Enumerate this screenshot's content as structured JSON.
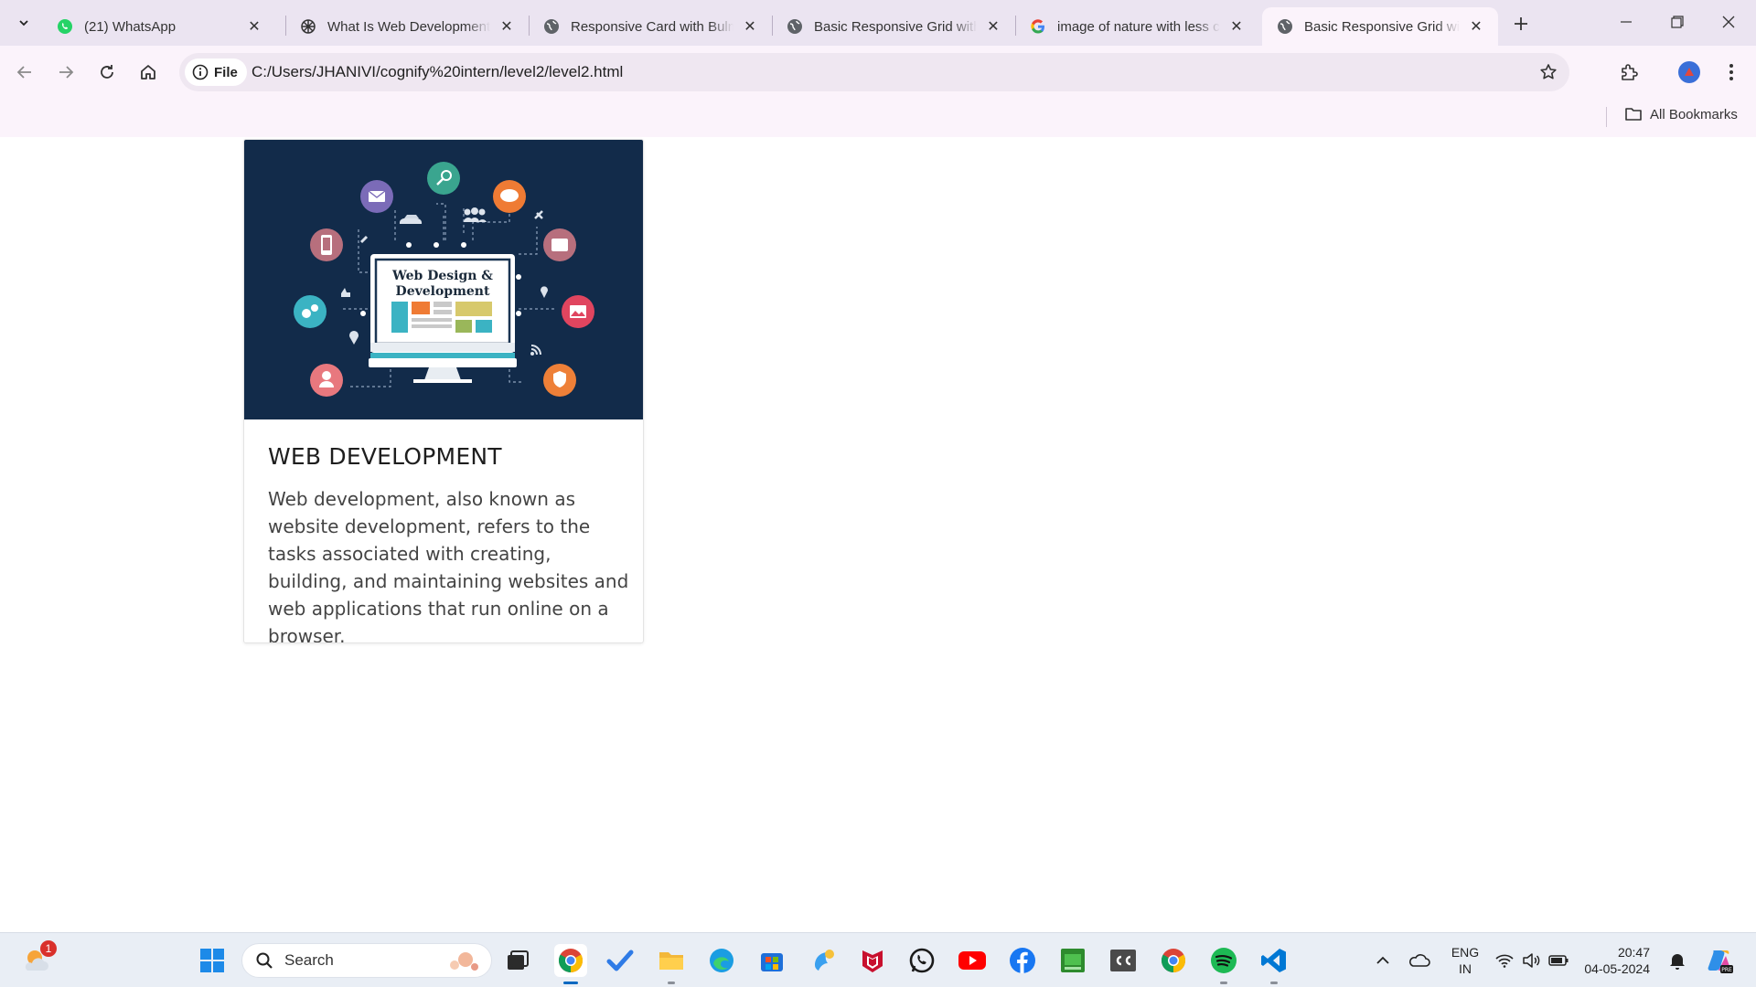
{
  "browser": {
    "tabs": [
      {
        "title": "(21) WhatsApp",
        "favicon": "whatsapp-icon",
        "active": false
      },
      {
        "title": "What Is Web Development",
        "favicon": "openai-icon",
        "active": false
      },
      {
        "title": "Responsive Card with Bulma",
        "favicon": "globe-icon",
        "active": false
      },
      {
        "title": "Basic Responsive Grid with",
        "favicon": "globe-icon",
        "active": false
      },
      {
        "title": "image of nature with less c",
        "favicon": "google-icon",
        "active": false
      },
      {
        "title": "Basic Responsive Grid with",
        "favicon": "globe-icon",
        "active": true
      }
    ],
    "address": {
      "chip_label": "File",
      "url": "C:/Users/JHANIVI/cognify%20intern/level2/level2.html"
    },
    "bookmarks": {
      "all_label": "All Bookmarks"
    }
  },
  "card": {
    "image_caption_line1": "Web Design &",
    "image_caption_line2": "Development",
    "title": "WEB DEVELOPMENT",
    "description": "Web development, also known as website development, refers to the tasks associated with creating, building, and maintaining websites and web applications that run online on a browser."
  },
  "taskbar": {
    "search_placeholder": "Search",
    "weather_badge": "1",
    "language_line1": "ENG",
    "language_line2": "IN",
    "time": "20:47",
    "date": "04-05-2024"
  },
  "colors": {
    "accent": "#0067c0",
    "card_image_bg": "#122b4a",
    "tab_strip": "#ebe4f1",
    "toolbar": "#fbf3fb"
  }
}
